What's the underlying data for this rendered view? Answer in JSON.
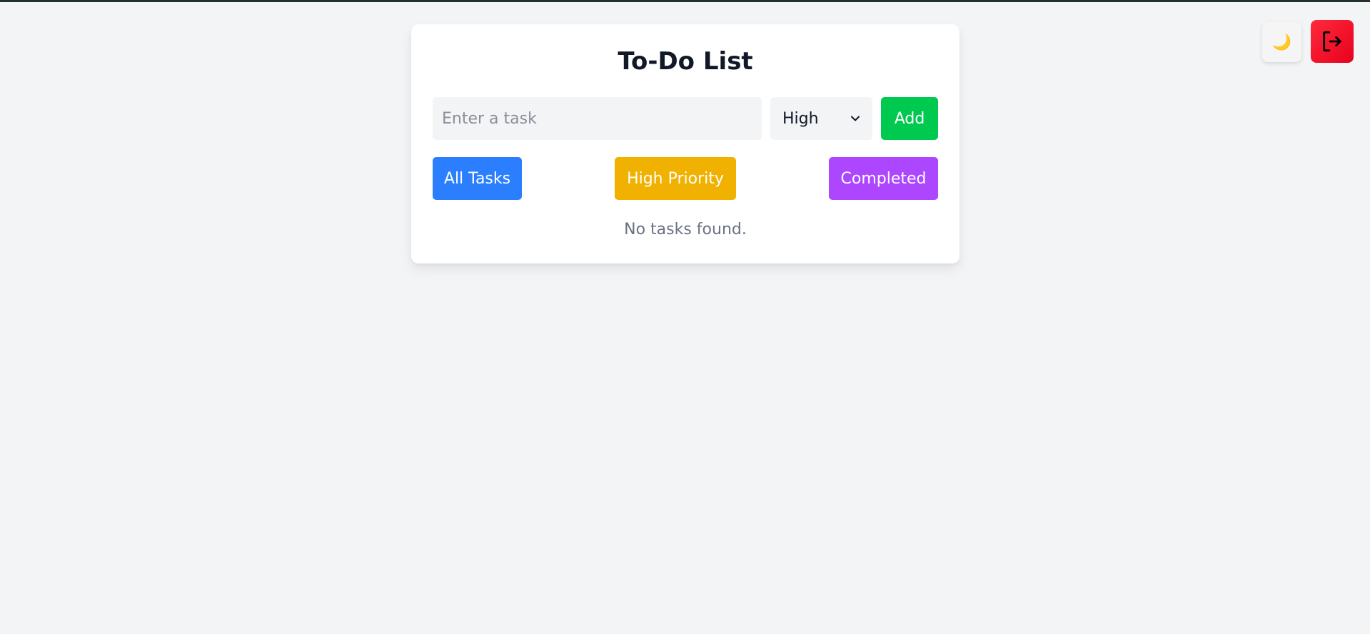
{
  "page": {
    "title": "To-Do List"
  },
  "form": {
    "task_placeholder": "Enter a task",
    "task_value": "",
    "priority_selected": "High",
    "add_label": "Add"
  },
  "filters": {
    "all_label": "All Tasks",
    "high_label": "High Priority",
    "completed_label": "Completed"
  },
  "list": {
    "empty_message": "No tasks found."
  },
  "top_right": {
    "theme_icon": "moon-icon",
    "theme_glyph": "🌙",
    "logout_icon": "logout-icon"
  },
  "colors": {
    "add": "#00c950",
    "all_tasks": "#2b7fff",
    "high_priority": "#f0b100",
    "completed": "#ad46ff",
    "logout": "#f5091e"
  }
}
